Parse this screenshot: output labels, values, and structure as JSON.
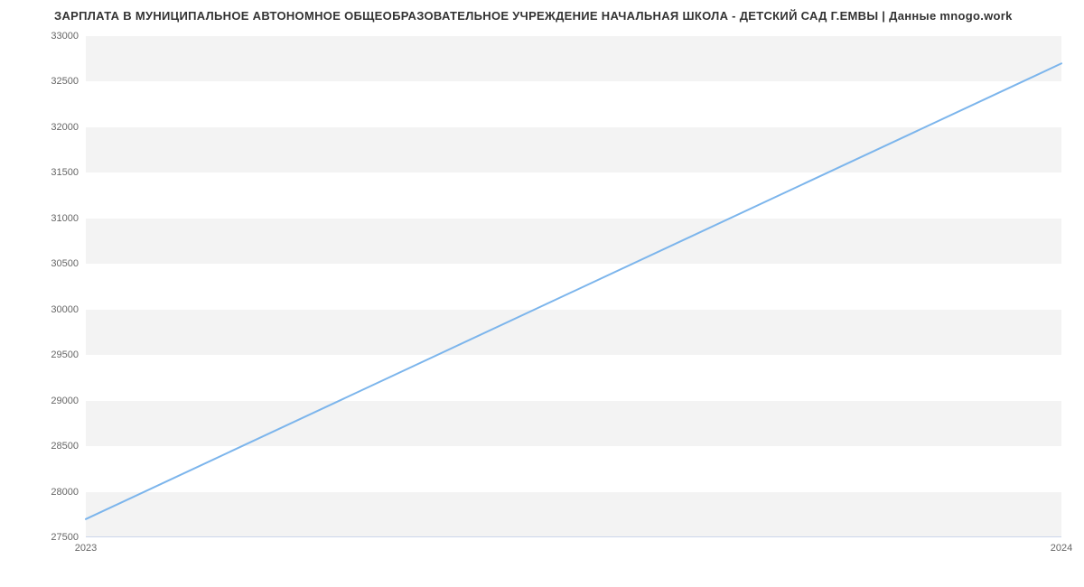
{
  "title": "ЗАРПЛАТА В МУНИЦИПАЛЬНОЕ АВТОНОМНОЕ ОБЩЕОБРАЗОВАТЕЛЬНОЕ УЧРЕЖДЕНИЕ НАЧАЛЬНАЯ ШКОЛА - ДЕТСКИЙ САД Г.ЕМВЫ | Данные mnogo.work",
  "chart_data": {
    "type": "line",
    "title": "ЗАРПЛАТА В МУНИЦИПАЛЬНОЕ АВТОНОМНОЕ ОБЩЕОБРАЗОВАТЕЛЬНОЕ УЧРЕЖДЕНИЕ НАЧАЛЬНАЯ ШКОЛА - ДЕТСКИЙ САД Г.ЕМВЫ | Данные mnogo.work",
    "xlabel": "",
    "ylabel": "",
    "x": [
      "2023",
      "2024"
    ],
    "values": [
      27700,
      32700
    ],
    "ylim": [
      27500,
      33000
    ],
    "y_ticks": [
      27500,
      28000,
      28500,
      29000,
      29500,
      30000,
      30500,
      31000,
      31500,
      32000,
      32500,
      33000
    ],
    "x_ticks": [
      "2023",
      "2024"
    ],
    "line_color": "#7cb5ec"
  }
}
